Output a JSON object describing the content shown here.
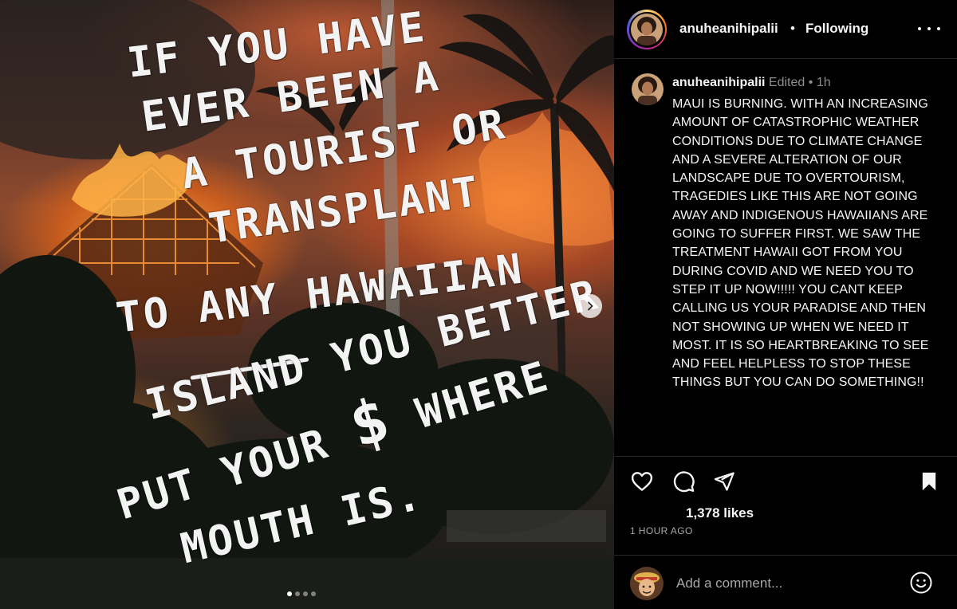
{
  "post": {
    "overlay_lines": [
      "IF YOU HAVE",
      "EVER BEEN A",
      "A TOURIST OR",
      "TRANSPLANT",
      "TO ANY HAWAIIAN",
      "ISLAND YOU BETTER",
      "PUT YOUR",
      "$",
      "WHERE",
      "MOUTH IS."
    ],
    "carousel": {
      "total": 4,
      "current": 1
    }
  },
  "header": {
    "username": "anuheanihipalii",
    "separator": "•",
    "follow_state": "Following"
  },
  "caption": {
    "username": "anuheanihipalii",
    "edited": "Edited",
    "separator": "•",
    "age": "1h",
    "text": "MAUI IS BURNING. WITH AN INCREASING AMOUNT OF CATASTROPHIC WEATHER CONDITIONS DUE TO CLIMATE CHANGE AND A SEVERE ALTERATION OF OUR LANDSCAPE DUE TO OVERTOURISM, TRAGEDIES LIKE THIS ARE NOT GOING AWAY AND INDIGENOUS HAWAIIANS ARE GOING TO SUFFER FIRST. WE SAW THE TREATMENT HAWAII GOT FROM YOU DURING COVID AND WE NEED YOU TO STEP IT UP NOW!!!!! YOU CANT KEEP CALLING US YOUR PARADISE AND THEN NOT SHOWING UP WHEN WE NEED IT MOST. IT IS SO HEARTBREAKING TO SEE AND FEEL HELPLESS TO STOP THESE THINGS BUT YOU CAN DO SOMETHING!!"
  },
  "actions": {
    "icons": [
      "heart-icon",
      "comment-icon",
      "share-icon",
      "bookmark-icon"
    ],
    "likes": "1,378 likes",
    "timestamp": "1 HOUR AGO"
  },
  "comment": {
    "placeholder": "Add a comment...",
    "emoji_icon": "smiley-icon"
  },
  "colors": {
    "background": "#000000",
    "text": "#f5f5f5",
    "muted": "#8e8e8e",
    "divider": "#262626"
  }
}
